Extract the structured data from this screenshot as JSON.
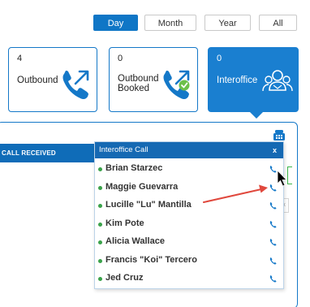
{
  "time_range": {
    "options": [
      "Day",
      "Month",
      "Year",
      "All"
    ],
    "active": "Day"
  },
  "cards": [
    {
      "count": "4",
      "label": "Outbound",
      "icon": "phone-outgoing-icon"
    },
    {
      "count": "0",
      "label": "Outbound\nBooked",
      "icon": "phone-booked-check-icon"
    },
    {
      "count": "0",
      "label": "Interoffice",
      "icon": "users-group-icon",
      "active": true
    }
  ],
  "panel": {
    "call_received_header": "CALL RECEIVED",
    "panel_icon": "phone-desk-icon",
    "side_button_label": "x"
  },
  "popup": {
    "title": "Interoffice Call",
    "close_label": "x",
    "contacts": [
      {
        "name": "Brian Starzec",
        "status": "online"
      },
      {
        "name": "Maggie Guevarra",
        "status": "online"
      },
      {
        "name": "Lucille \"Lu\" Mantilla",
        "status": "online"
      },
      {
        "name": "Kim Pote",
        "status": "online"
      },
      {
        "name": "Alicia Wallace",
        "status": "online"
      },
      {
        "name": "Francis \"Koi\" Tercero",
        "status": "online"
      },
      {
        "name": "Jed Cruz",
        "status": "online"
      }
    ]
  },
  "colors": {
    "accent": "#1478c8",
    "header_blue": "#1569b3",
    "online_green": "#3aa24a",
    "annotation_red": "#e0483d"
  }
}
